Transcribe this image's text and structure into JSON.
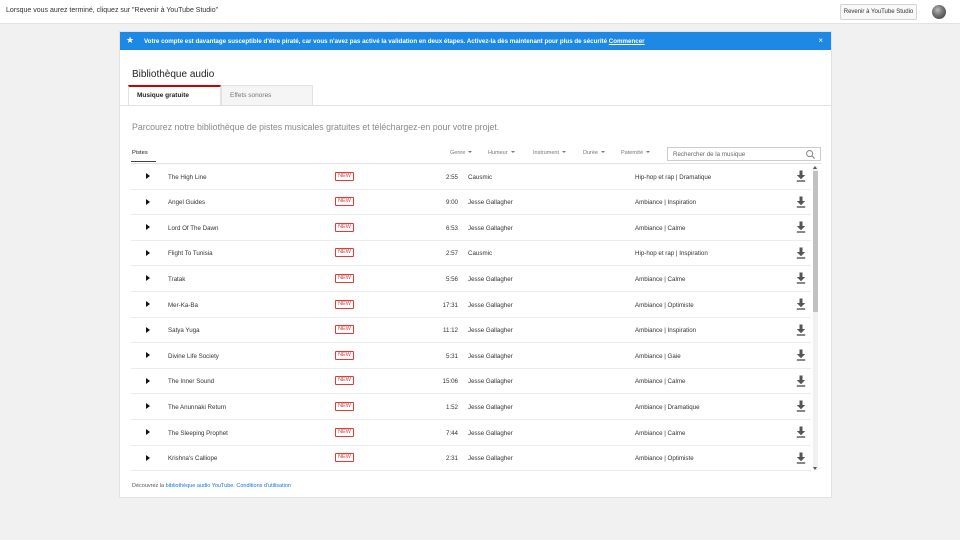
{
  "topbar": {
    "message": "Lorsque vous aurez terminé, cliquez sur \"Revenir à YouTube Studio\"",
    "back_button": "Revenir à YouTube Studio"
  },
  "banner": {
    "text": "Votre compte est davantage susceptible d'être piraté, car vous n'avez pas activé la validation en deux étapes. Activez-la dès maintenant pour plus de sécurité",
    "link": "Commencer",
    "close": "×",
    "color": "#1e88e5"
  },
  "page": {
    "title": "Bibliothèque audio",
    "subtitle": "Parcourez notre bibliothèque de pistes musicales gratuites et téléchargez-en pour votre projet."
  },
  "tabs": [
    {
      "label": "Musique gratuite",
      "active": true
    },
    {
      "label": "Effets sonores",
      "active": false
    }
  ],
  "filters": {
    "tracks_tab": "Pistes",
    "genre": "Genre",
    "mood": "Humeur",
    "instrument": "Instrument",
    "duration": "Durée",
    "attribution": "Paternité",
    "search_placeholder": "Rechercher de la musique"
  },
  "badge_label": "NEW",
  "tracks": [
    {
      "title": "The High Line",
      "duration": "2:55",
      "artist": "Causmic",
      "genre": "Hip-hop et rap | Dramatique"
    },
    {
      "title": "Angel Guides",
      "duration": "9:00",
      "artist": "Jesse Gallagher",
      "genre": "Ambiance | Inspiration"
    },
    {
      "title": "Lord Of The Dawn",
      "duration": "6:53",
      "artist": "Jesse Gallagher",
      "genre": "Ambiance | Calme"
    },
    {
      "title": "Flight To Tunisia",
      "duration": "2:57",
      "artist": "Causmic",
      "genre": "Hip-hop et rap | Inspiration"
    },
    {
      "title": "Tratak",
      "duration": "5:56",
      "artist": "Jesse Gallagher",
      "genre": "Ambiance | Calme"
    },
    {
      "title": "Mer-Ka-Ba",
      "duration": "17:31",
      "artist": "Jesse Gallagher",
      "genre": "Ambiance | Optimiste"
    },
    {
      "title": "Satya Yuga",
      "duration": "11:12",
      "artist": "Jesse Gallagher",
      "genre": "Ambiance | Inspiration"
    },
    {
      "title": "Divine Life Society",
      "duration": "5:31",
      "artist": "Jesse Gallagher",
      "genre": "Ambiance | Gaie"
    },
    {
      "title": "The Inner Sound",
      "duration": "15:06",
      "artist": "Jesse Gallagher",
      "genre": "Ambiance | Calme"
    },
    {
      "title": "The Anunnaki Return",
      "duration": "1:52",
      "artist": "Jesse Gallagher",
      "genre": "Ambiance | Dramatique"
    },
    {
      "title": "The Sleeping Prophet",
      "duration": "7:44",
      "artist": "Jesse Gallagher",
      "genre": "Ambiance | Calme"
    },
    {
      "title": "Krishna's Calliope",
      "duration": "2:31",
      "artist": "Jesse Gallagher",
      "genre": "Ambiance | Optimiste"
    }
  ],
  "footer": {
    "prefix": "Découvrez la",
    "library_link": "bibliothèque audio YouTube.",
    "terms_link": "Conditions d'utilisation"
  }
}
